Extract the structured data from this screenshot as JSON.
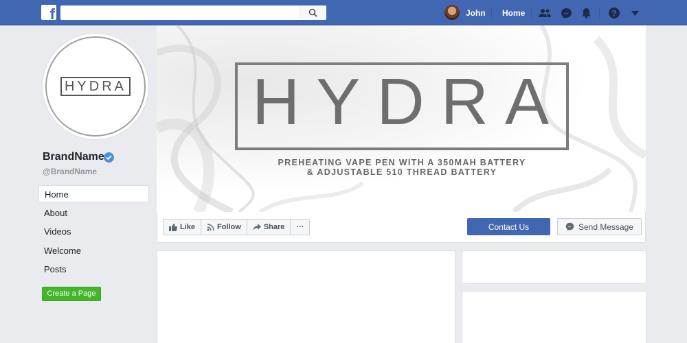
{
  "topbar": {
    "logo_letter": "f",
    "search_placeholder": "",
    "user_name": "John",
    "home_label": "Home",
    "icons": [
      "friends-icon",
      "messenger-icon",
      "notifications-icon",
      "help-icon",
      "chevron-down-icon"
    ],
    "bar_color": "#4267b2"
  },
  "profile": {
    "logo_text": "HYDRA",
    "name": "BrandName",
    "handle": "@BrandName"
  },
  "nav": {
    "items": [
      {
        "label": "Home",
        "active": true
      },
      {
        "label": "About"
      },
      {
        "label": "Videos"
      },
      {
        "label": "Welcome"
      },
      {
        "label": "Posts"
      }
    ],
    "create_label": "Create a Page"
  },
  "cover": {
    "title": "HYDRA",
    "line1": "PREHEATING VAPE PEN WITH A 350MAH BATTERY",
    "line2": "& ADJUSTABLE 510 THREAD BATTERY"
  },
  "actions": {
    "like_label": "Like",
    "follow_label": "Follow",
    "share_label": "Share",
    "more_label": "···",
    "contact_label": "Contact Us",
    "message_label": "Send Message",
    "accent": "#4267b2",
    "create_color": "#42b72a"
  }
}
